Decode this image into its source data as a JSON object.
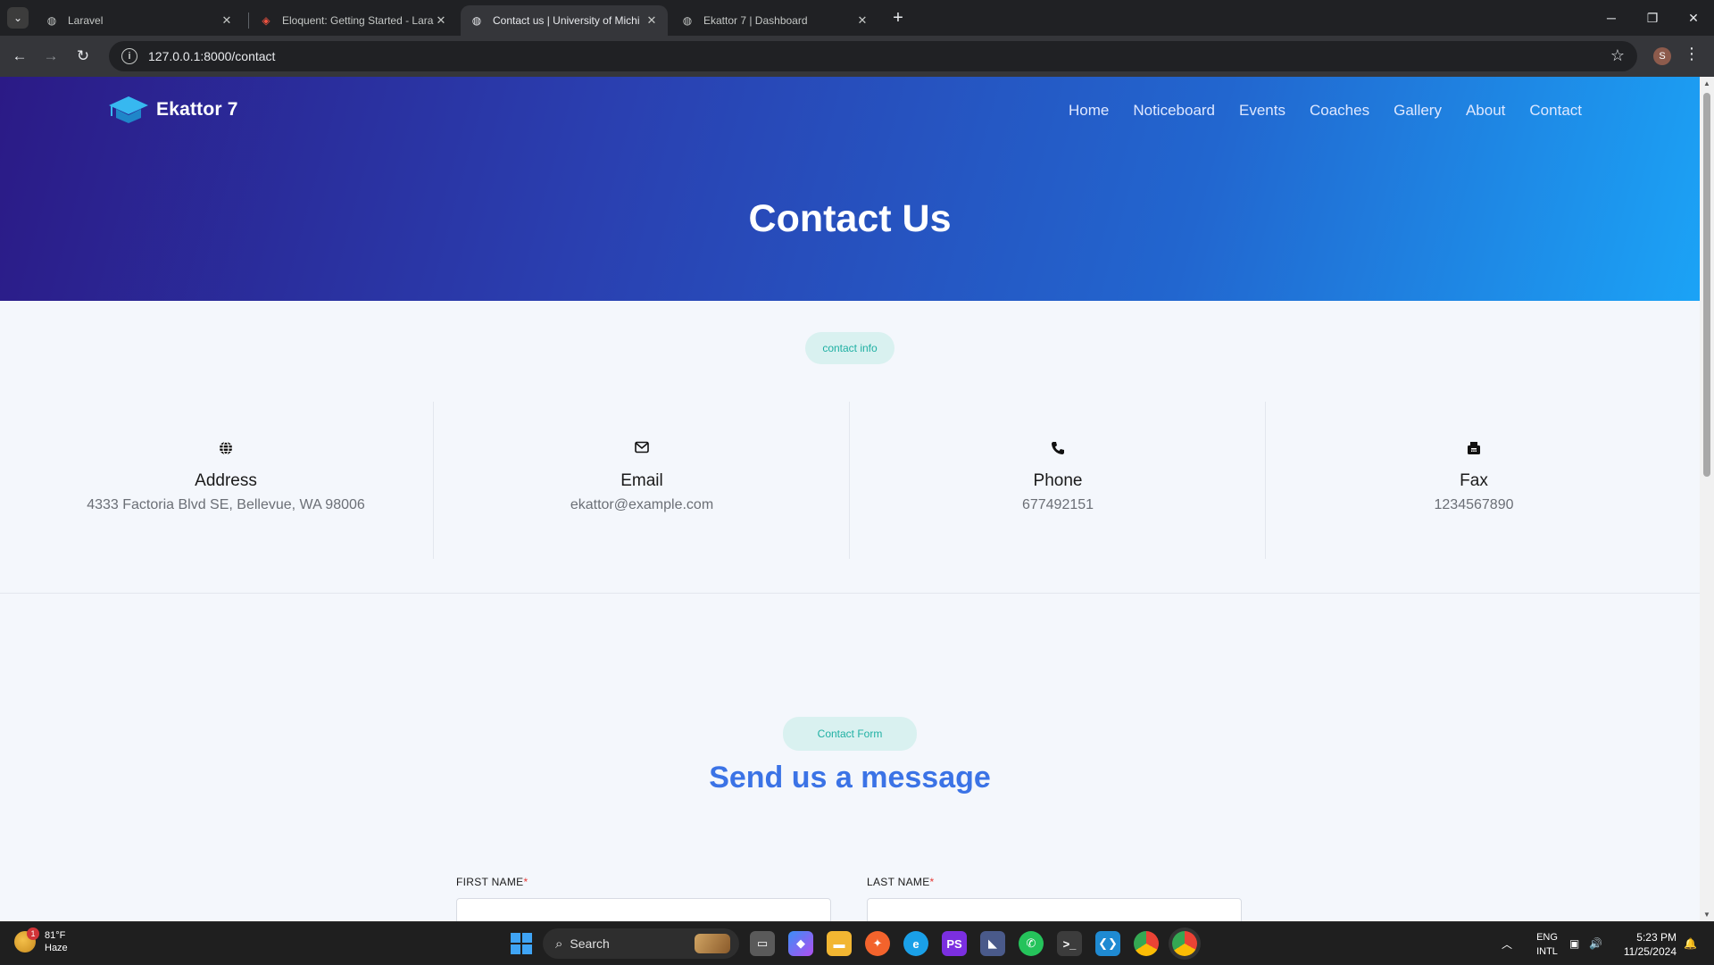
{
  "browser": {
    "tabs": [
      {
        "title": "Laravel",
        "active": false
      },
      {
        "title": "Eloquent: Getting Started - Lara",
        "active": false
      },
      {
        "title": "Contact us | University of Michi",
        "active": true
      },
      {
        "title": "Ekattor 7 | Dashboard",
        "active": false
      }
    ],
    "url": "127.0.0.1:8000/contact",
    "profile_initial": "S"
  },
  "site": {
    "logo_text": "Ekattor 7",
    "nav": [
      "Home",
      "Noticeboard",
      "Events",
      "Coaches",
      "Gallery",
      "About",
      "Contact"
    ],
    "hero_title": "Contact Us",
    "contact_info_pill": "contact info",
    "contact_items": [
      {
        "icon": "globe-icon",
        "label": "Address",
        "value": "4333 Factoria Blvd SE, Bellevue, WA 98006"
      },
      {
        "icon": "envelope-icon",
        "label": "Email",
        "value": "ekattor@example.com"
      },
      {
        "icon": "phone-icon",
        "label": "Phone",
        "value": "677492151"
      },
      {
        "icon": "fax-icon",
        "label": "Fax",
        "value": "1234567890"
      }
    ],
    "form_pill": "Contact Form",
    "form_title": "Send us a message",
    "form": {
      "first_name_label": "FIRST NAME",
      "last_name_label": "LAST NAME",
      "required_mark": "*"
    }
  },
  "taskbar": {
    "weather_temp": "81°F",
    "weather_desc": "Haze",
    "weather_badge": "1",
    "search_placeholder": "Search",
    "lang_line1": "ENG",
    "lang_line2": "INTL",
    "time": "5:23 PM",
    "date": "11/25/2024"
  },
  "colors": {
    "hero_start": "#2b1a86",
    "hero_end": "#1ba3f6",
    "accent_teal": "#1fb0a3",
    "title_blue": "#3b73e6",
    "required_red": "#e53935"
  }
}
